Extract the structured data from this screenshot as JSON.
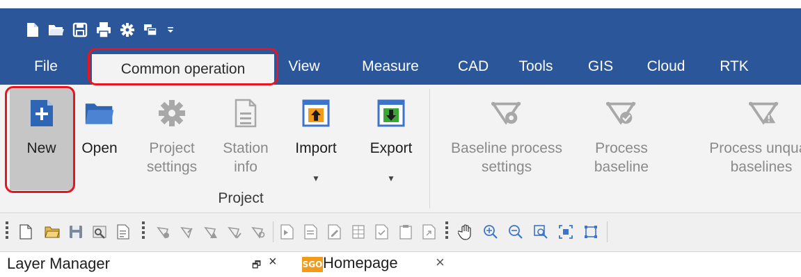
{
  "quick_access": {
    "icons": [
      "new-file-icon",
      "open-folder-icon",
      "save-icon",
      "print-icon",
      "settings-gear-icon",
      "window-switch-icon",
      "customize-dropdown-icon"
    ]
  },
  "tabs": [
    {
      "label": "File",
      "active": false
    },
    {
      "label": "Common operation",
      "active": true
    },
    {
      "label": "View",
      "active": false
    },
    {
      "label": "Measure",
      "active": false
    },
    {
      "label": "CAD",
      "active": false
    },
    {
      "label": "Tools",
      "active": false
    },
    {
      "label": "GIS",
      "active": false
    },
    {
      "label": "Cloud",
      "active": false
    },
    {
      "label": "RTK",
      "active": false
    }
  ],
  "ribbon": {
    "project_group": {
      "label": "Project",
      "buttons": [
        {
          "label": "New",
          "icon": "new-project-icon",
          "enabled": true
        },
        {
          "label": "Open",
          "icon": "open-folder-icon",
          "enabled": true
        },
        {
          "label": "Project\nsettings",
          "icon": "gear-icon",
          "enabled": false
        },
        {
          "label": "Station\ninfo",
          "icon": "document-icon",
          "enabled": false
        },
        {
          "label": "Import",
          "icon": "import-icon",
          "enabled": true,
          "dropdown": true
        },
        {
          "label": "Export",
          "icon": "export-icon",
          "enabled": true,
          "dropdown": true
        }
      ]
    },
    "baseline_group": {
      "buttons": [
        {
          "label": "Baseline process\nsettings",
          "icon": "baseline-settings-icon",
          "enabled": false
        },
        {
          "label": "Process\nbaseline",
          "icon": "process-baseline-icon",
          "enabled": false
        },
        {
          "label": "Process unquali\nbaselines",
          "icon": "process-unqualified-icon",
          "enabled": false
        }
      ]
    }
  },
  "panels": {
    "layer_manager_title": "Layer Manager",
    "pin_glyph": "🗗",
    "close_glyph": "×",
    "document_tab": {
      "logo": "SGO",
      "title": "Homepage",
      "close_glyph": "×"
    }
  },
  "colors": {
    "title_bar": "#2b579a",
    "ribbon_bg": "#f3f3f3",
    "highlight": "#e8141e",
    "new_button_bg": "#c6c6c6",
    "sgo_logo": "#f29b1b",
    "import_export_accent": "#f29b1b",
    "export_arrow": "#3aa635",
    "disabled_icon": "#9c9c9c",
    "open_folder": "#3b6ebf"
  }
}
